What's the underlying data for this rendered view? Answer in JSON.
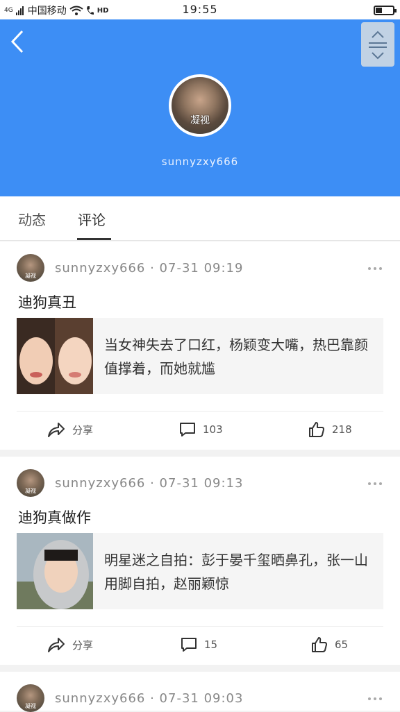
{
  "status_bar": {
    "carrier": "中国移动",
    "network": "4G",
    "hd": "HD",
    "time": "19:55"
  },
  "profile": {
    "avatar_caption": "凝视",
    "username": "sunnyzxy666"
  },
  "tabs": [
    {
      "label": "动态"
    },
    {
      "label": "评论"
    }
  ],
  "posts": [
    {
      "user": "sunnyzxy666",
      "time": "07-31 09:19",
      "title": "迪狗真丑",
      "card_text": "当女神失去了口红，杨颖变大嘴，热巴靠颜值撑着，而她就尴",
      "share_label": "分享",
      "comments": "103",
      "likes": "218"
    },
    {
      "user": "sunnyzxy666",
      "time": "07-31 09:13",
      "title": "迪狗真做作",
      "card_text": "明星迷之自拍：彭于晏千玺晒鼻孔，张一山用脚自拍，赵丽颖惊",
      "share_label": "分享",
      "comments": "15",
      "likes": "65"
    },
    {
      "user": "sunnyzxy666",
      "time": "07-31 09:03"
    }
  ],
  "icons": {
    "back": "chevron-left-icon",
    "menu": "collapse-menu-icon",
    "share": "share-icon",
    "comment": "comment-icon",
    "like": "thumbs-up-icon",
    "more": "more-dots-icon"
  },
  "colors": {
    "header": "#3d8ef5",
    "background": "#f2f2f2"
  }
}
